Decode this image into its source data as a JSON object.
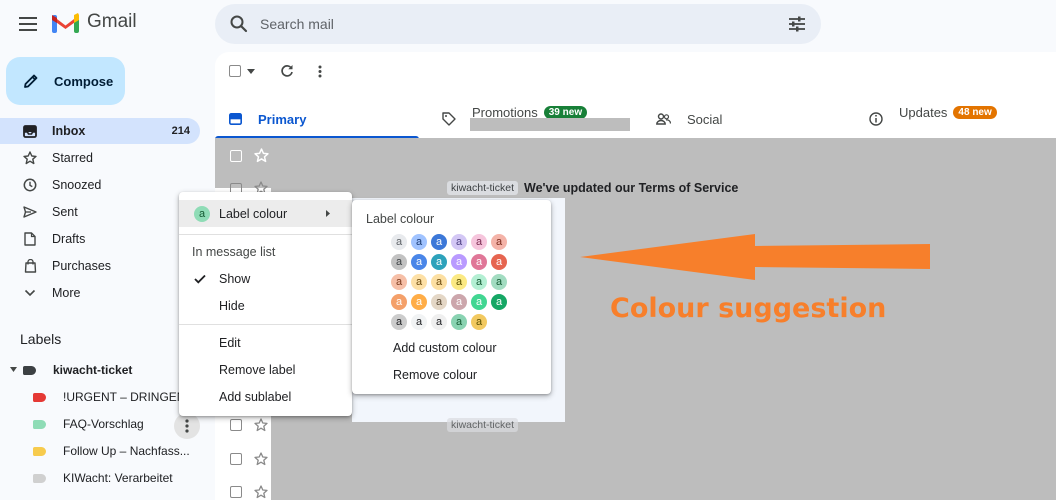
{
  "app": {
    "name": "Gmail"
  },
  "search": {
    "placeholder": "Search mail"
  },
  "compose": {
    "label": "Compose"
  },
  "nav": [
    {
      "label": "Inbox",
      "count": "214",
      "active": true
    },
    {
      "label": "Starred"
    },
    {
      "label": "Snoozed"
    },
    {
      "label": "Sent"
    },
    {
      "label": "Drafts"
    },
    {
      "label": "Purchases"
    },
    {
      "label": "More"
    }
  ],
  "labels": {
    "heading": "Labels",
    "items": [
      {
        "name": "kiwacht-ticket",
        "color": "#3c4043",
        "bold": true
      },
      {
        "name": "!URGENT – DRINGEND",
        "color": "#e53935"
      },
      {
        "name": "FAQ-Vorschlag",
        "color": "#8fdcb6"
      },
      {
        "name": "Follow Up – Nachfass...",
        "color": "#f7cb4d"
      },
      {
        "name": "KIWacht: Verarbeitet",
        "color": "#d0d0d0"
      }
    ]
  },
  "tabs": {
    "primary": "Primary",
    "promotions": "Promotions",
    "promotions_badge": "39 new",
    "social": "Social",
    "updates": "Updates",
    "updates_badge": "48 new"
  },
  "rows": {
    "chip_1": "kiwacht-ticket",
    "subject_1": "We've updated our Terms of Service",
    "chip_2": "kiwacht-ticket"
  },
  "context_menu": {
    "label_colour": "Label colour",
    "label_colour_glyph": "a",
    "in_message_list": "In message list",
    "show": "Show",
    "hide": "Hide",
    "edit": "Edit",
    "remove_label": "Remove label",
    "add_sublabel": "Add sublabel"
  },
  "submenu": {
    "title": "Label colour",
    "swatch_glyph": "a",
    "swatches": [
      [
        {
          "bg": "#e8eaed",
          "fg": "#5f6368"
        },
        {
          "bg": "#a0c3ff",
          "fg": "#1a3a72"
        },
        {
          "bg": "#3c78d8",
          "fg": "#ffffff"
        },
        {
          "bg": "#d3c7f5",
          "fg": "#4a3d80"
        },
        {
          "bg": "#f6c5dc",
          "fg": "#7a2a50"
        },
        {
          "bg": "#f4b3a8",
          "fg": "#7a2a1c"
        }
      ],
      [
        {
          "bg": "#c2c2c2",
          "fg": "#3c4043"
        },
        {
          "bg": "#4a86e8",
          "fg": "#ffffff"
        },
        {
          "bg": "#2da2bb",
          "fg": "#ffffff"
        },
        {
          "bg": "#b99aff",
          "fg": "#ffffff"
        },
        {
          "bg": "#e07798",
          "fg": "#ffffff"
        },
        {
          "bg": "#e66550",
          "fg": "#ffffff"
        }
      ],
      [
        {
          "bg": "#f6bfa7",
          "fg": "#7a3a1c"
        },
        {
          "bg": "#fde0a6",
          "fg": "#6b4a0e"
        },
        {
          "bg": "#fcdfa2",
          "fg": "#6b4a0e"
        },
        {
          "bg": "#fbe983",
          "fg": "#594f00"
        },
        {
          "bg": "#b3efd3",
          "fg": "#145a32"
        },
        {
          "bg": "#a2dcc1",
          "fg": "#145a32"
        }
      ],
      [
        {
          "bg": "#f4a06a",
          "fg": "#ffffff"
        },
        {
          "bg": "#ffad47",
          "fg": "#ffffff"
        },
        {
          "bg": "#e4d7c6",
          "fg": "#5a4a34"
        },
        {
          "bg": "#cca6ac",
          "fg": "#ffffff"
        },
        {
          "bg": "#42d692",
          "fg": "#ffffff"
        },
        {
          "bg": "#16a765",
          "fg": "#ffffff"
        }
      ],
      [
        {
          "bg": "#cccccc",
          "fg": "#202124"
        },
        {
          "bg": "#f1f3f4",
          "fg": "#202124"
        },
        {
          "bg": "#efefef",
          "fg": "#202124"
        },
        {
          "bg": "#89d3b2",
          "fg": "#145a32"
        },
        {
          "bg": "#f2c960",
          "fg": "#594f00"
        }
      ]
    ],
    "add_custom": "Add custom colour",
    "remove_colour": "Remove colour"
  },
  "annotation": {
    "text": "Colour suggestion",
    "color": "#f77f2b"
  }
}
